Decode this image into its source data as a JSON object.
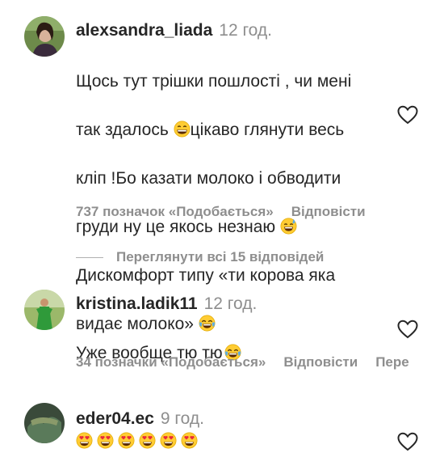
{
  "comments": [
    {
      "username": "alexsandra_liada",
      "time": "12 год.",
      "lines": [
        "Щось тут трішки пошлості , чи мені",
        "так здалось",
        "цікаво глянути весь",
        "кліп !Бо казати молоко і обводити",
        "груди ну це якось незнаю",
        "Дискомфорт типу «ти корова яка",
        "видає молоко»"
      ],
      "likes": "737 позначок «Подобається»",
      "reply": "Відповісти"
    },
    {
      "username": "kristina.ladik11",
      "time": "12 год.",
      "text": "Уже вообще тю тю",
      "likes": "34 позначки «Подобається»",
      "reply": "Відповісти",
      "translate": "Пере"
    },
    {
      "username": "eder04.ec",
      "time": "9 год."
    }
  ],
  "view_replies": "Переглянути всі 15 відповідей",
  "icons": {
    "like": "heart-outline-icon",
    "grin": "grinning-face-emoji",
    "sweat": "grinning-face-with-sweat-emoji",
    "joy": "face-with-tears-of-joy-emoji",
    "heart_eyes": "smiling-face-with-heart-eyes-emoji"
  },
  "colors": {
    "text": "#262626",
    "secondary": "#8e8e8e"
  }
}
